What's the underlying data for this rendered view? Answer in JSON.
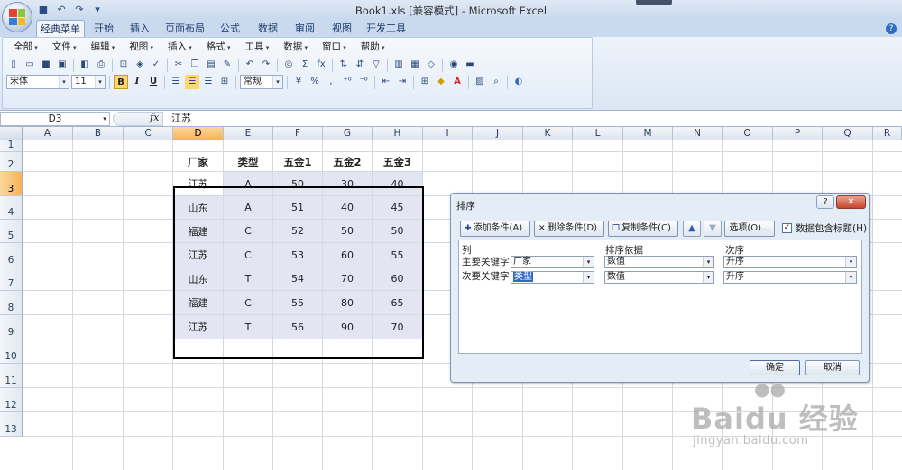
{
  "window": {
    "title": "Book1.xls  [兼容模式] - Microsoft Excel"
  },
  "tabs": [
    "经典菜单",
    "开始",
    "插入",
    "页面布局",
    "公式",
    "数据",
    "审阅",
    "视图",
    "开发工具"
  ],
  "classic_menu": [
    "全部",
    "文件",
    "编辑",
    "视图",
    "插入",
    "格式",
    "工具",
    "数据",
    "窗口",
    "帮助"
  ],
  "toolbar": {
    "font_name": "宋体",
    "font_size": "11",
    "bold": "B",
    "italic": "I",
    "underline": "U",
    "number_format": "常规",
    "percent": "%",
    "comma": ",",
    "sum": "Σ",
    "fx": "fx"
  },
  "formula_bar": {
    "name_box": "D3",
    "fx_label": "fx",
    "content": "江苏"
  },
  "columns": [
    "A",
    "B",
    "C",
    "D",
    "E",
    "F",
    "G",
    "H",
    "I",
    "J",
    "K",
    "L",
    "M",
    "N",
    "O",
    "P",
    "Q",
    "R"
  ],
  "rows": [
    "1",
    "2",
    "3",
    "4",
    "5",
    "6",
    "7",
    "8",
    "9",
    "10",
    "11",
    "12",
    "13"
  ],
  "sheet": {
    "headers": [
      "厂家",
      "类型",
      "五金1",
      "五金2",
      "五金3"
    ],
    "rows": [
      [
        "江苏",
        "A",
        "50",
        "30",
        "40"
      ],
      [
        "山东",
        "A",
        "51",
        "40",
        "45"
      ],
      [
        "福建",
        "C",
        "52",
        "50",
        "50"
      ],
      [
        "江苏",
        "C",
        "53",
        "60",
        "55"
      ],
      [
        "山东",
        "T",
        "54",
        "70",
        "60"
      ],
      [
        "福建",
        "C",
        "55",
        "80",
        "65"
      ],
      [
        "江苏",
        "T",
        "56",
        "90",
        "70"
      ]
    ]
  },
  "sort_dialog": {
    "title": "排序",
    "help": "?",
    "close": "✕",
    "add_level": "添加条件(A)",
    "delete_level": "删除条件(D)",
    "copy_level": "复制条件(C)",
    "options": "选项(O)...",
    "header_checkbox_label": "数据包含标题(H)",
    "col_header": "列",
    "sort_on_header": "排序依据",
    "order_header": "次序",
    "primary_label": "主要关键字",
    "secondary_label": "次要关键字",
    "primary_key": "厂家",
    "secondary_key": "类型",
    "primary_sort_on": "数值",
    "secondary_sort_on": "数值",
    "primary_order": "升序",
    "secondary_order": "升序",
    "ok": "确定",
    "cancel": "取消"
  },
  "watermark": {
    "brand": "Baidu 经验",
    "url": "jingyan.baidu.com"
  },
  "colors": {
    "accent": "#f6b35a",
    "selection": "#3169c6",
    "table_fill": "#e3e6f2",
    "ribbon": "#dbe6f4"
  }
}
